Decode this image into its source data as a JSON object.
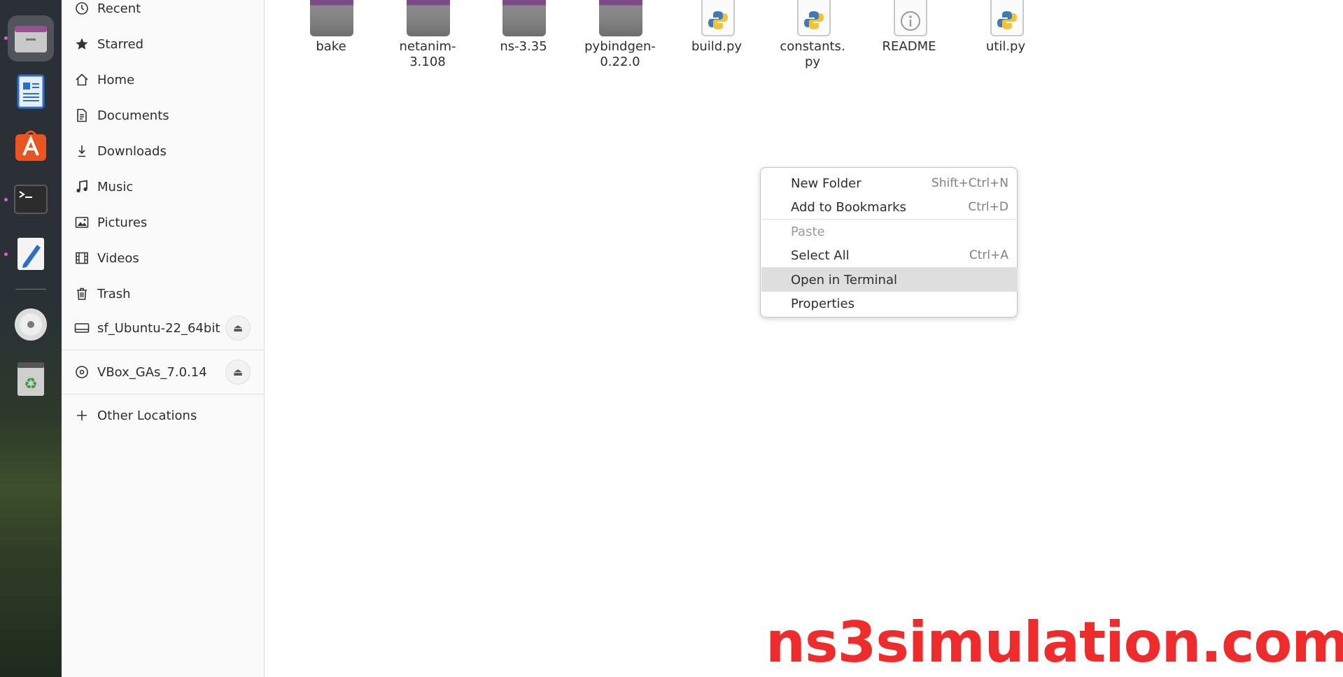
{
  "dock": {
    "items": [
      {
        "name": "files-icon",
        "active": true
      },
      {
        "name": "writer-icon"
      },
      {
        "name": "app-center-icon"
      },
      {
        "name": "terminal-icon"
      },
      {
        "name": "text-editor-icon"
      },
      {
        "name": "disc-icon"
      },
      {
        "name": "trash-icon"
      }
    ]
  },
  "sidebar": {
    "items": [
      {
        "label": "Recent",
        "icon": "clock-icon"
      },
      {
        "label": "Starred",
        "icon": "star-icon"
      },
      {
        "label": "Home",
        "icon": "home-icon"
      },
      {
        "label": "Documents",
        "icon": "document-icon"
      },
      {
        "label": "Downloads",
        "icon": "download-icon"
      },
      {
        "label": "Music",
        "icon": "music-note-icon"
      },
      {
        "label": "Pictures",
        "icon": "picture-icon"
      },
      {
        "label": "Videos",
        "icon": "film-icon"
      },
      {
        "label": "Trash",
        "icon": "trash-icon"
      }
    ],
    "drives": [
      {
        "label": "sf_Ubuntu-22_64bit",
        "icon": "drive-icon",
        "eject": "⏏"
      },
      {
        "label": "VBox_GAs_7.0.14",
        "icon": "disc-icon",
        "eject": "⏏"
      }
    ],
    "other": {
      "label": "Other Locations",
      "icon": "plus-icon"
    }
  },
  "files": [
    {
      "name": "bake",
      "type": "folder"
    },
    {
      "name": "netanim-3.108",
      "type": "folder"
    },
    {
      "name": "ns-3.35",
      "type": "folder"
    },
    {
      "name": "pybindgen-0.22.0",
      "type": "folder"
    },
    {
      "name": "build.py",
      "type": "python"
    },
    {
      "name": "constants.py",
      "type": "python"
    },
    {
      "name": "README",
      "type": "info"
    },
    {
      "name": "util.py",
      "type": "python"
    }
  ],
  "file_labels": {
    "bake": "bake",
    "netanim_1": "netanim-",
    "netanim_2": "3.108",
    "ns": "ns-3.35",
    "pybindgen_1": "pybindgen-",
    "pybindgen_2": "0.22.0",
    "build": "build.py",
    "constants_1": "constants.",
    "constants_2": "py",
    "readme": "README",
    "util": "util.py"
  },
  "context_menu": {
    "new_folder": {
      "label": "New Folder",
      "shortcut": "Shift+Ctrl+N"
    },
    "add_bookmark": {
      "label": "Add to Bookmarks",
      "shortcut": "Ctrl+D"
    },
    "paste": {
      "label": "Paste",
      "disabled": true
    },
    "select_all": {
      "label": "Select All",
      "shortcut": "Ctrl+A"
    },
    "open_terminal": {
      "label": "Open in Terminal",
      "highlighted": true
    },
    "properties": {
      "label": "Properties"
    }
  },
  "watermark": "ns3simulation.com"
}
